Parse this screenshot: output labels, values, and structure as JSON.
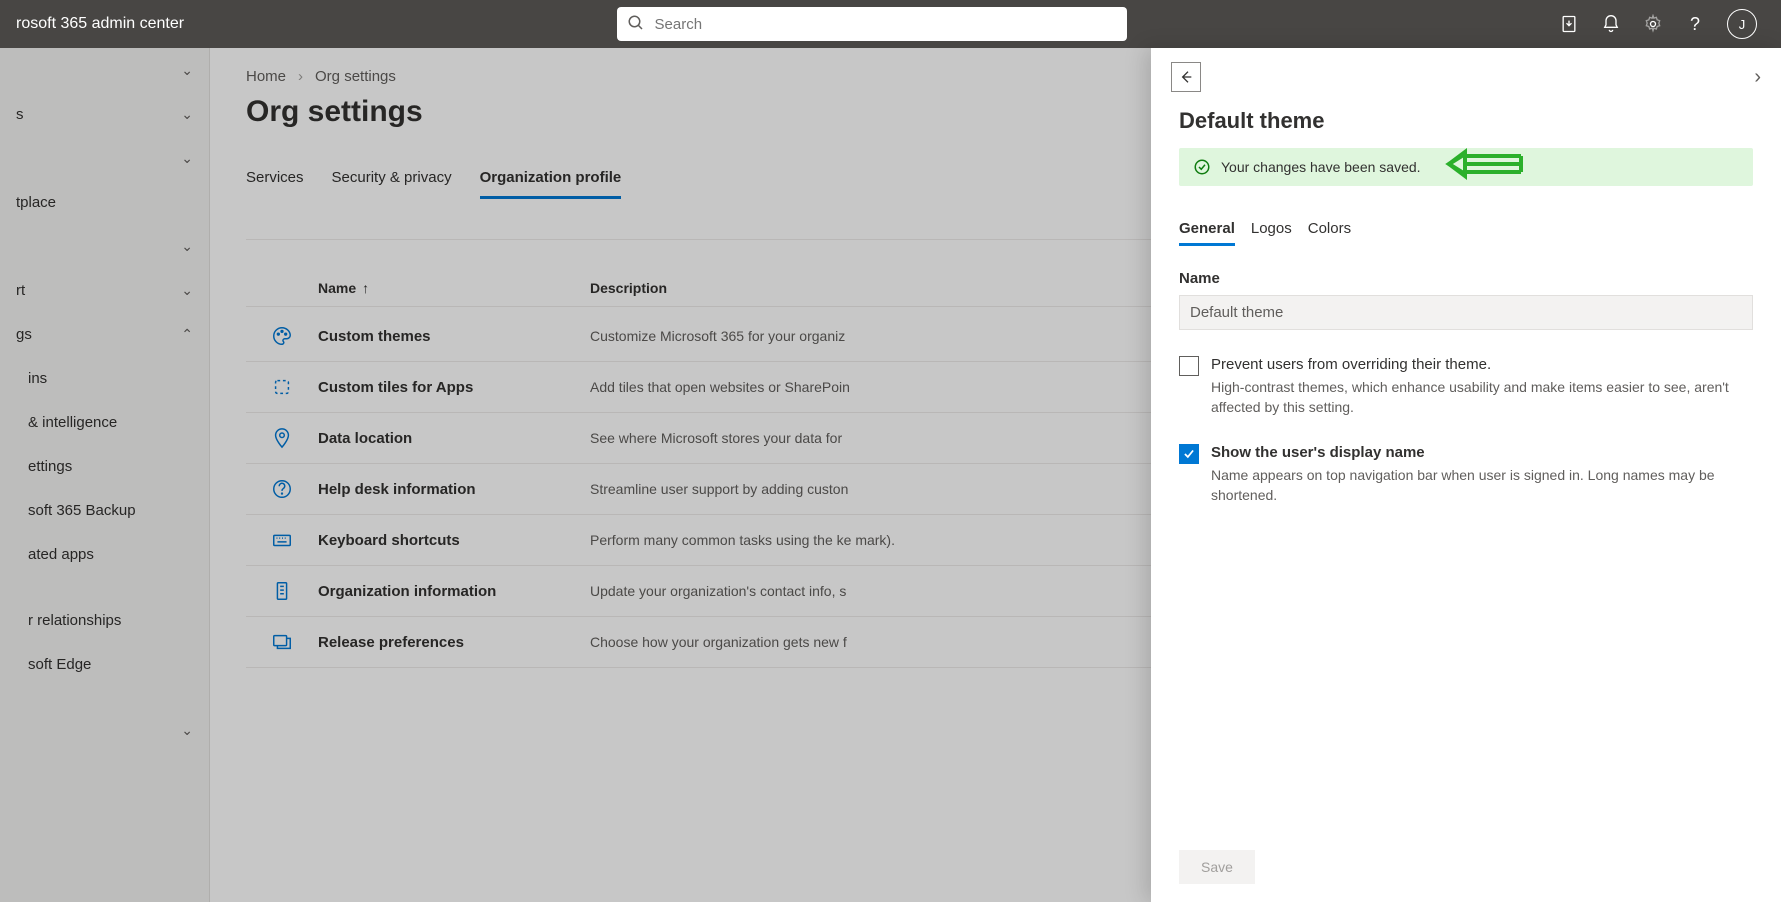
{
  "header": {
    "title": "rosoft 365 admin center",
    "search_placeholder": "Search",
    "avatar_initial": "J"
  },
  "sidebar": {
    "items": [
      {
        "label": "",
        "chevron": true
      },
      {
        "label": "s",
        "chevron": true
      },
      {
        "label": "",
        "chevron": true
      },
      {
        "label": "tplace",
        "chevron": false
      },
      {
        "label": "",
        "chevron": true
      },
      {
        "label": "rt",
        "chevron": true
      },
      {
        "label": "gs",
        "chevron": true,
        "expanded": true
      },
      {
        "label": "ins",
        "sub": true
      },
      {
        "label": "& intelligence",
        "sub": true
      },
      {
        "label": "ettings",
        "sub": true
      },
      {
        "label": "soft 365 Backup",
        "sub": true
      },
      {
        "label": "ated apps",
        "sub": true
      },
      {
        "label": "r relationships",
        "sub": true
      },
      {
        "label": "soft Edge",
        "sub": true
      },
      {
        "label": "",
        "chevron": true
      }
    ]
  },
  "breadcrumb": {
    "home": "Home",
    "current": "Org settings"
  },
  "page_title": "Org settings",
  "tabs": [
    {
      "label": "Services",
      "active": false
    },
    {
      "label": "Security & privacy",
      "active": false
    },
    {
      "label": "Organization profile",
      "active": true
    }
  ],
  "columns": {
    "name": "Name",
    "description": "Description"
  },
  "rows": [
    {
      "icon": "palette",
      "name": "Custom themes",
      "desc": "Customize Microsoft 365 for your organiz"
    },
    {
      "icon": "tile",
      "name": "Custom tiles for Apps",
      "desc": "Add tiles that open websites or SharePoin"
    },
    {
      "icon": "location",
      "name": "Data location",
      "desc": "See where Microsoft stores your data for "
    },
    {
      "icon": "help",
      "name": "Help desk information",
      "desc": "Streamline user support by adding custon"
    },
    {
      "icon": "keyboard",
      "name": "Keyboard shortcuts",
      "desc": "Perform many common tasks using the ke mark)."
    },
    {
      "icon": "org",
      "name": "Organization information",
      "desc": "Update your organization's contact info, s"
    },
    {
      "icon": "release",
      "name": "Release preferences",
      "desc": "Choose how your organization gets new f"
    }
  ],
  "panel": {
    "title": "Default theme",
    "success_msg": "Your changes have been saved.",
    "tabs": [
      {
        "label": "General",
        "active": true
      },
      {
        "label": "Logos",
        "active": false
      },
      {
        "label": "Colors",
        "active": false
      }
    ],
    "name_label": "Name",
    "name_value": "Default theme",
    "opt1_label": "Prevent users from overriding their theme.",
    "opt1_help": "High-contrast themes, which enhance usability and make items easier to see, aren't affected by this setting.",
    "opt2_label": "Show the user's display name",
    "opt2_help": "Name appears on top navigation bar when user is signed in. Long names may be shortened.",
    "save_btn": "Save"
  }
}
